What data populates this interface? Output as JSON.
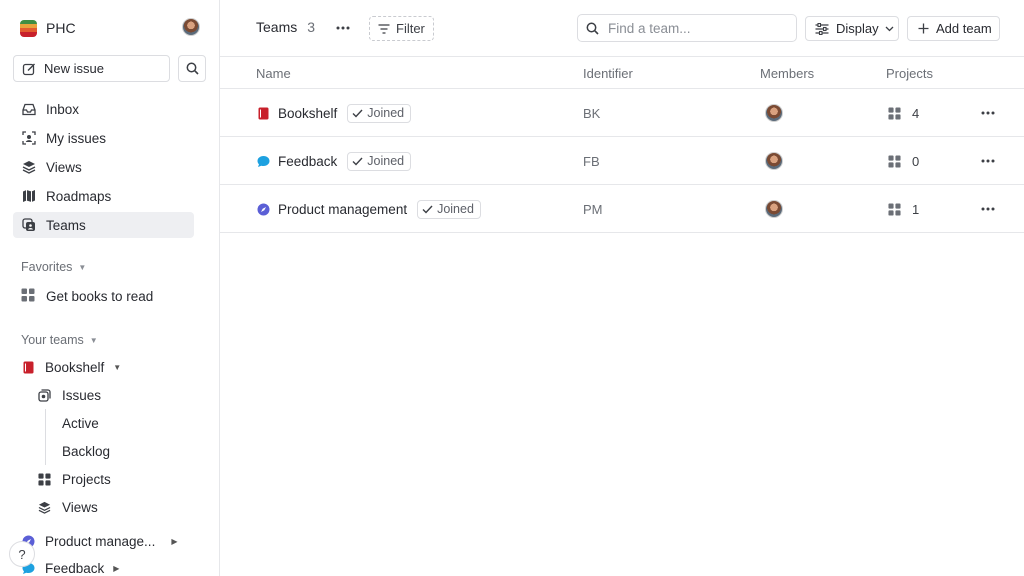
{
  "workspace": {
    "name": "PHC"
  },
  "sidebar": {
    "new_issue_label": "New issue",
    "nav": [
      {
        "label": "Inbox",
        "icon": "inbox-icon"
      },
      {
        "label": "My issues",
        "icon": "my-issues-icon"
      },
      {
        "label": "Views",
        "icon": "layers-icon"
      },
      {
        "label": "Roadmaps",
        "icon": "map-icon"
      },
      {
        "label": "Teams",
        "icon": "team-icon",
        "active": true
      }
    ],
    "favorites_label": "Favorites",
    "favorites": [
      {
        "label": "Get books to read",
        "icon": "grid-icon"
      }
    ],
    "your_teams_label": "Your teams",
    "teams": [
      {
        "label": "Bookshelf",
        "icon": "book-icon",
        "expanded": true
      },
      {
        "label": "Product manage...",
        "icon": "compass-icon",
        "expanded": false
      },
      {
        "label": "Feedback",
        "icon": "chat-icon",
        "expanded": false
      }
    ],
    "bookshelf_children": {
      "issues": "Issues",
      "active": "Active",
      "backlog": "Backlog",
      "projects": "Projects",
      "views": "Views"
    },
    "help_label": "?"
  },
  "header": {
    "title": "Teams",
    "count": "3",
    "filter_label": "Filter",
    "search_placeholder": "Find a team...",
    "display_label": "Display",
    "add_team_label": "Add team"
  },
  "table": {
    "columns": {
      "name": "Name",
      "identifier": "Identifier",
      "members": "Members",
      "projects": "Projects"
    },
    "joined_label": "Joined",
    "rows": [
      {
        "name": "Bookshelf",
        "identifier": "BK",
        "projects": "4",
        "icon": "book-icon",
        "color": "#c8202b"
      },
      {
        "name": "Feedback",
        "identifier": "FB",
        "projects": "0",
        "icon": "chat-icon",
        "color": "#1da1e0"
      },
      {
        "name": "Product management",
        "identifier": "PM",
        "projects": "1",
        "icon": "compass-icon",
        "color": "#5b5fd6"
      }
    ]
  },
  "colors": {
    "accent_book": "#c8202b",
    "accent_chat": "#1da1e0",
    "accent_compass": "#5b5fd6",
    "active_bg": "#eeeff2"
  }
}
